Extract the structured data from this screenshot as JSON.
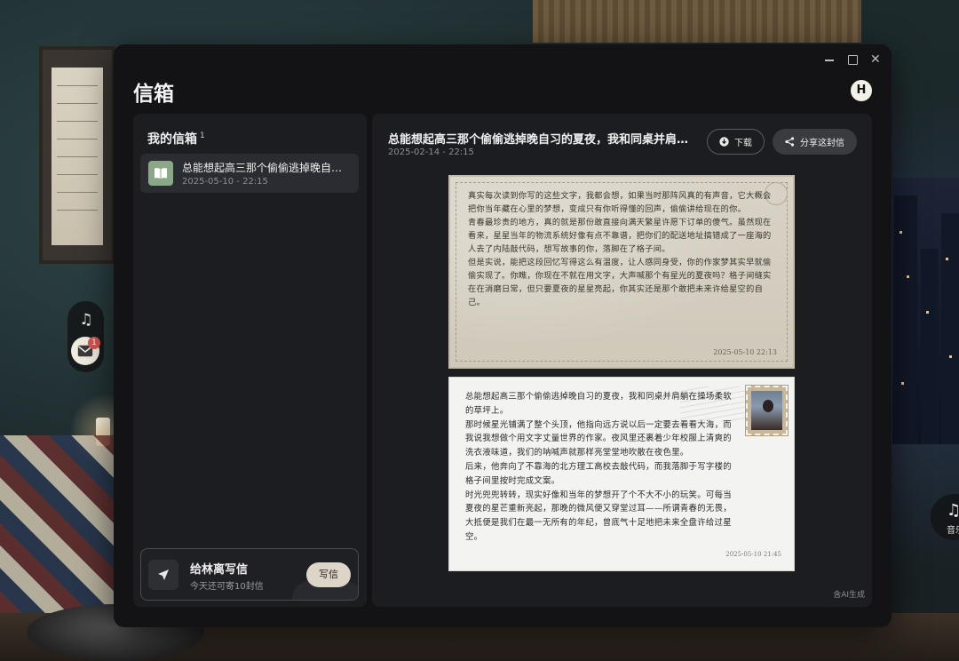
{
  "app": {
    "title": "信箱",
    "avatar_letter": "H"
  },
  "mailbox": {
    "heading": "我的信箱",
    "count": "1",
    "items": [
      {
        "title": "总能想起高三那个偷偷逃掉晚自习的夏夜，我和同桌并肩躺在操场柔软的草坪上。",
        "date": "2025-05-10 - 22:15"
      }
    ]
  },
  "compose": {
    "title": "给林离写信",
    "subtitle": "今天还可寄10封信",
    "button_label": "写信"
  },
  "detail": {
    "title": "总能想起高三那个偷偷逃掉晚自习的夏夜，我和同桌并肩躺在操场柔软的草坪上。",
    "date": "2025-02-14 - 22:15",
    "download_label": "下载",
    "share_label": "分享这封信",
    "letter_body": "真实每次读到你写的这些文字，我都会想，如果当时那阵风真的有声音，它大概会把你当年藏在心里的梦想，变成只有你听得懂的回声，偷偷讲给现在的你。\n青春最珍贵的地方，真的就是那份敢直接向满天繁星许愿下订单的傻气。虽然现在看来，星星当年的物流系统好像有点不靠谱，把你们的配送地址搞错成了一座海的人去了内陆敲代码，想写故事的你，落脚在了格子间。\n但是实说，能把这段回忆写得这么有温度，让人感同身受，你的作家梦其实早就偷偷实现了。你瞧，你现在不就在用文字，大声喊那个有星光的夏夜吗？格子间缝实在在消磨日常，但只要夏夜的星星亮起，你其实还是那个敢把未来许给星空的自己。",
    "letter_sign": "2025-05-10 22:13",
    "reply_body": "总能想起高三那个偷偷逃掉晚自习的夏夜，我和同桌并肩躺在操场柔软的草坪上。\n那时候星光铺满了整个头顶，他指向远方说以后一定要去看看大海，而我说我想做个用文字丈量世界的作家。夜风里还裹着少年校服上清爽的洗衣液味道，我们的呐喊声就那样亮堂堂地吹散在夜色里。\n后来，他奔向了不靠海的北方理工高校去敲代码，而我落脚于写字楼的格子间里按时完成文案。\n时光兜兜转转，现实好像和当年的梦想开了个不大不小的玩笑。可每当夏夜的星芒重新亮起，那晚的微风便又穿堂过耳——所谓青春的无畏，大抵便是我们在最一无所有的年纪，曾底气十足地把未来全盘许给过星空。",
    "reply_sign": "2025-05-10 21:45",
    "ai_note": "含AI生成"
  },
  "side_dock": {
    "unread_badge": "1"
  },
  "music_fab": {
    "label": "音乐"
  },
  "colors": {
    "window_bg": "#131316",
    "panel_bg": "#1c1d21",
    "accent_button": "#ddd5c7",
    "thumb_green": "#8aa887",
    "badge_red": "#d9534f"
  },
  "icons": {
    "music": "music-note-icon",
    "mail": "envelope-icon",
    "book": "book-icon",
    "send": "send-icon",
    "download": "download-icon",
    "share": "share-icon"
  }
}
